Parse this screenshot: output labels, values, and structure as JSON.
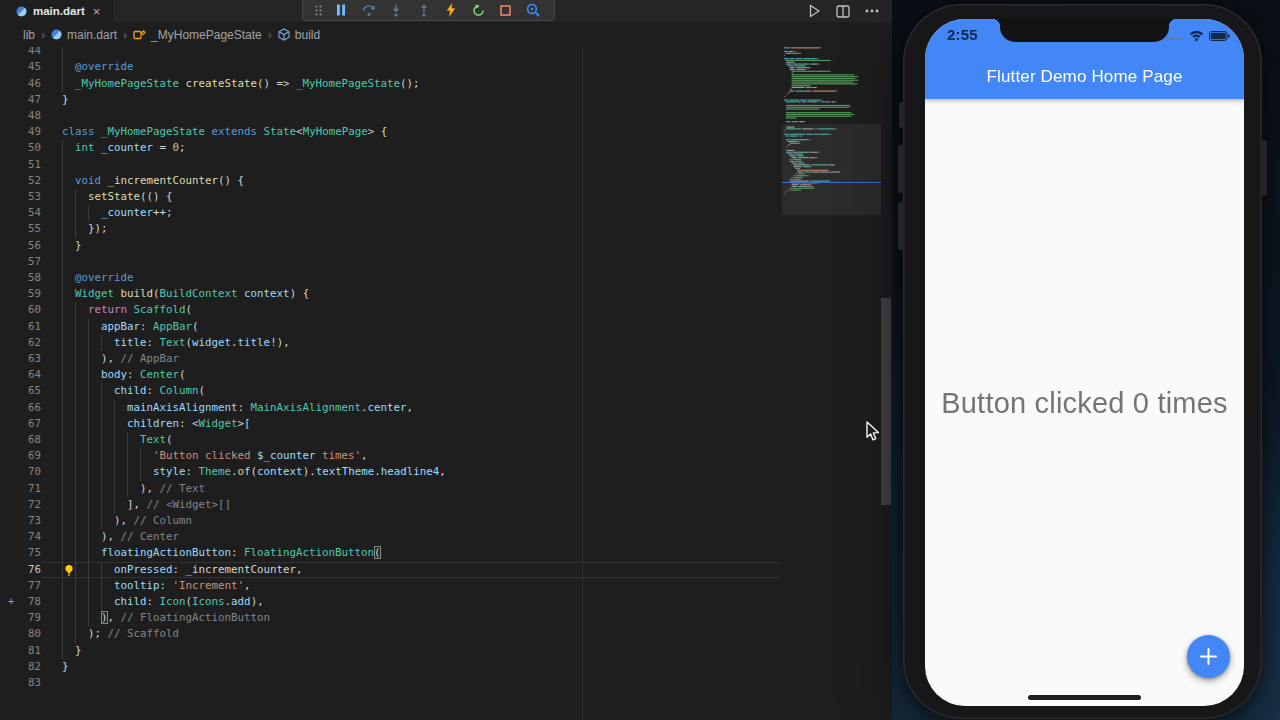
{
  "vscode": {
    "tab_bar": {
      "active_tab": {
        "label": "main.dart",
        "icon": "dart-icon",
        "close_label": "×"
      },
      "editor_actions": [
        {
          "name": "run-button",
          "icon": "play-icon"
        },
        {
          "name": "split-editor-button",
          "icon": "split-editor-icon"
        },
        {
          "name": "more-actions-button",
          "icon": "ellipsis-icon"
        }
      ]
    },
    "debug_toolbar": {
      "items": [
        {
          "name": "drag-grip",
          "icon": "grip-dots-icon",
          "enabled": true
        },
        {
          "name": "pause-button",
          "icon": "pause-icon",
          "enabled": true,
          "color": "#75beff"
        },
        {
          "name": "step-over-button",
          "icon": "step-over-icon",
          "enabled": false,
          "color": "#5b7a94"
        },
        {
          "name": "step-into-button",
          "icon": "step-into-icon",
          "enabled": false,
          "color": "#5b7a94"
        },
        {
          "name": "step-out-button",
          "icon": "step-out-icon",
          "enabled": false,
          "color": "#5b7a94"
        },
        {
          "name": "hot-reload-button",
          "icon": "lightning-bolt-icon",
          "enabled": true,
          "color": "#ffb62e"
        },
        {
          "name": "restart-button",
          "icon": "restart-icon",
          "enabled": true,
          "color": "#89d185"
        },
        {
          "name": "stop-button",
          "icon": "stop-square-icon",
          "enabled": true,
          "color": "#f48771"
        },
        {
          "name": "widget-inspector-button",
          "icon": "inspector-magnifier-icon",
          "enabled": true,
          "color": "#3794ff"
        }
      ]
    },
    "breadcrumbs": [
      {
        "label": "lib",
        "icon": null
      },
      {
        "label": "main.dart",
        "icon": "dart-icon"
      },
      {
        "label": "_MyHomePageState",
        "icon": "symbol-class-icon"
      },
      {
        "label": "build",
        "icon": "symbol-method-icon"
      }
    ],
    "editor": {
      "current_line": 76,
      "token_colors": {
        "kw": "#569cd6",
        "ctl": "#c586c0",
        "type": "#4ec9b0",
        "fn": "#dcdcaa",
        "var": "#9cdcfe",
        "str": "#ce9178",
        "num": "#b5cea8",
        "cmt": "#85858a",
        "pun": "#d4d4d4"
      },
      "gutter_decorations": {
        "76": "lightbulb-icon",
        "78": "plus-icon"
      },
      "lines": [
        {
          "n": 44,
          "ind": 0,
          "t": []
        },
        {
          "n": 45,
          "ind": 2,
          "t": [
            [
              "@override",
              "kw"
            ]
          ]
        },
        {
          "n": 46,
          "ind": 2,
          "t": [
            [
              "_MyHomePageState",
              "type"
            ],
            [
              " ",
              "pun"
            ],
            [
              "createState",
              "fn"
            ],
            [
              "() => ",
              "pun"
            ],
            [
              "_MyHomePageState",
              "type"
            ],
            [
              "();",
              "pun"
            ]
          ]
        },
        {
          "n": 47,
          "ind": 0,
          "t": [
            [
              "}",
              "pun"
            ]
          ]
        },
        {
          "n": 48,
          "ind": 0,
          "t": []
        },
        {
          "n": 49,
          "ind": 0,
          "t": [
            [
              "class",
              "kw"
            ],
            [
              " ",
              "pun"
            ],
            [
              "_MyHomePageState",
              "type"
            ],
            [
              " ",
              "pun"
            ],
            [
              "extends",
              "kw"
            ],
            [
              " ",
              "pun"
            ],
            [
              "State",
              "type"
            ],
            [
              "<",
              "pun"
            ],
            [
              "MyHomePage",
              "type"
            ],
            [
              "> {",
              "pun"
            ]
          ]
        },
        {
          "n": 50,
          "ind": 2,
          "t": [
            [
              "int",
              "type"
            ],
            [
              " ",
              "pun"
            ],
            [
              "_counter",
              "var"
            ],
            [
              " = ",
              "pun"
            ],
            [
              "0",
              "num"
            ],
            [
              ";",
              "pun"
            ]
          ]
        },
        {
          "n": 51,
          "ind": 2,
          "t": []
        },
        {
          "n": 52,
          "ind": 2,
          "t": [
            [
              "void",
              "kw"
            ],
            [
              " ",
              "pun"
            ],
            [
              "_incrementCounter",
              "fn"
            ],
            [
              "() {",
              "pun"
            ]
          ]
        },
        {
          "n": 53,
          "ind": 4,
          "t": [
            [
              "setState",
              "fn"
            ],
            [
              "(() {",
              "pun"
            ]
          ]
        },
        {
          "n": 54,
          "ind": 6,
          "t": [
            [
              "_counter",
              "var"
            ],
            [
              "++;",
              "pun"
            ]
          ]
        },
        {
          "n": 55,
          "ind": 4,
          "t": [
            [
              "});",
              "pun"
            ]
          ]
        },
        {
          "n": 56,
          "ind": 2,
          "t": [
            [
              "}",
              "pun"
            ]
          ]
        },
        {
          "n": 57,
          "ind": 2,
          "t": []
        },
        {
          "n": 58,
          "ind": 2,
          "t": [
            [
              "@override",
              "kw"
            ]
          ]
        },
        {
          "n": 59,
          "ind": 2,
          "t": [
            [
              "Widget",
              "type"
            ],
            [
              " ",
              "pun"
            ],
            [
              "build",
              "fn"
            ],
            [
              "(",
              "pun"
            ],
            [
              "BuildContext",
              "type"
            ],
            [
              " ",
              "pun"
            ],
            [
              "context",
              "var"
            ],
            [
              ") {",
              "pun"
            ]
          ]
        },
        {
          "n": 60,
          "ind": 4,
          "t": [
            [
              "return",
              "ctl"
            ],
            [
              " ",
              "pun"
            ],
            [
              "Scaffold",
              "type"
            ],
            [
              "(",
              "pun"
            ]
          ]
        },
        {
          "n": 61,
          "ind": 6,
          "t": [
            [
              "appBar",
              "var"
            ],
            [
              ": ",
              "pun"
            ],
            [
              "AppBar",
              "type"
            ],
            [
              "(",
              "pun"
            ]
          ]
        },
        {
          "n": 62,
          "ind": 8,
          "t": [
            [
              "title",
              "var"
            ],
            [
              ": ",
              "pun"
            ],
            [
              "Text",
              "type"
            ],
            [
              "(",
              "pun"
            ],
            [
              "widget",
              "var"
            ],
            [
              ".",
              "pun"
            ],
            [
              "title",
              "var"
            ],
            [
              "!),",
              "pun"
            ]
          ]
        },
        {
          "n": 63,
          "ind": 6,
          "t": [
            [
              "), ",
              "pun"
            ],
            [
              "// AppBar",
              "cmt"
            ]
          ]
        },
        {
          "n": 64,
          "ind": 6,
          "t": [
            [
              "body",
              "var"
            ],
            [
              ": ",
              "pun"
            ],
            [
              "Center",
              "type"
            ],
            [
              "(",
              "pun"
            ]
          ]
        },
        {
          "n": 65,
          "ind": 8,
          "t": [
            [
              "child",
              "var"
            ],
            [
              ": ",
              "pun"
            ],
            [
              "Column",
              "type"
            ],
            [
              "(",
              "pun"
            ]
          ]
        },
        {
          "n": 66,
          "ind": 10,
          "t": [
            [
              "mainAxisAlignment",
              "var"
            ],
            [
              ": ",
              "pun"
            ],
            [
              "MainAxisAlignment",
              "type"
            ],
            [
              ".",
              "pun"
            ],
            [
              "center",
              "var"
            ],
            [
              ",",
              "pun"
            ]
          ]
        },
        {
          "n": 67,
          "ind": 10,
          "t": [
            [
              "children",
              "var"
            ],
            [
              ": <",
              "pun"
            ],
            [
              "Widget",
              "type"
            ],
            [
              ">[",
              "pun"
            ]
          ]
        },
        {
          "n": 68,
          "ind": 12,
          "t": [
            [
              "Text",
              "type"
            ],
            [
              "(",
              "pun"
            ]
          ]
        },
        {
          "n": 69,
          "ind": 14,
          "t": [
            [
              "'Button clicked ",
              "str"
            ],
            [
              "$_counter",
              "var"
            ],
            [
              " times'",
              "str"
            ],
            [
              ",",
              "pun"
            ]
          ]
        },
        {
          "n": 70,
          "ind": 14,
          "t": [
            [
              "style",
              "var"
            ],
            [
              ": ",
              "pun"
            ],
            [
              "Theme",
              "type"
            ],
            [
              ".",
              "pun"
            ],
            [
              "of",
              "fn"
            ],
            [
              "(",
              "pun"
            ],
            [
              "context",
              "var"
            ],
            [
              ").",
              "pun"
            ],
            [
              "textTheme",
              "var"
            ],
            [
              ".",
              "pun"
            ],
            [
              "headline4",
              "var"
            ],
            [
              ",",
              "pun"
            ]
          ]
        },
        {
          "n": 71,
          "ind": 12,
          "t": [
            [
              "), ",
              "pun"
            ],
            [
              "// Text",
              "cmt"
            ]
          ]
        },
        {
          "n": 72,
          "ind": 10,
          "t": [
            [
              "], ",
              "pun"
            ],
            [
              "// <Widget>[]",
              "cmt"
            ]
          ]
        },
        {
          "n": 73,
          "ind": 8,
          "t": [
            [
              "), ",
              "pun"
            ],
            [
              "// Column",
              "cmt"
            ]
          ]
        },
        {
          "n": 74,
          "ind": 6,
          "t": [
            [
              "), ",
              "pun"
            ],
            [
              "// Center",
              "cmt"
            ]
          ]
        },
        {
          "n": 75,
          "ind": 6,
          "t": [
            [
              "floatingActionButton",
              "var"
            ],
            [
              ": ",
              "pun"
            ],
            [
              "FloatingActionButton",
              "type"
            ],
            [
              "(",
              "pun",
              "m"
            ]
          ]
        },
        {
          "n": 76,
          "ind": 8,
          "t": [
            [
              "onPressed",
              "var"
            ],
            [
              ": ",
              "pun"
            ],
            [
              "_incrementCounter",
              "pun"
            ],
            [
              ",",
              "pun"
            ]
          ]
        },
        {
          "n": 77,
          "ind": 8,
          "t": [
            [
              "tooltip",
              "var"
            ],
            [
              ": ",
              "pun"
            ],
            [
              "'Increment'",
              "str"
            ],
            [
              ",",
              "pun"
            ]
          ]
        },
        {
          "n": 78,
          "ind": 8,
          "t": [
            [
              "child",
              "var"
            ],
            [
              ": ",
              "pun"
            ],
            [
              "Icon",
              "type"
            ],
            [
              "(",
              "pun"
            ],
            [
              "Icons",
              "type"
            ],
            [
              ".",
              "pun"
            ],
            [
              "add",
              "var"
            ],
            [
              "),",
              "pun"
            ]
          ]
        },
        {
          "n": 79,
          "ind": 6,
          "t": [
            [
              ")",
              "pun",
              "m"
            ],
            [
              ", ",
              "pun"
            ],
            [
              "// FloatingActionButton",
              "cmt"
            ]
          ]
        },
        {
          "n": 80,
          "ind": 4,
          "t": [
            [
              "); ",
              "pun"
            ],
            [
              "// Scaffold",
              "cmt"
            ]
          ]
        },
        {
          "n": 81,
          "ind": 2,
          "t": [
            [
              "}",
              "pun"
            ]
          ]
        },
        {
          "n": 82,
          "ind": 0,
          "t": [
            [
              "}",
              "pun"
            ]
          ]
        },
        {
          "n": 83,
          "ind": 0,
          "t": []
        }
      ]
    },
    "minimap": {
      "file_lines": [
        "import 'package:flutter/material.dart';",
        "",
        "void main() {",
        "  runApp(MyApp());",
        "}",
        "",
        "class MyApp extends StatelessWidget {",
        "  // This widget is the root of your application.",
        "  @override",
        "  Widget build(BuildContext context) {",
        "    return MaterialApp(",
        "      title: 'Flutter Demo',",
        "      theme: ThemeData(",
        "        // This is the theme of your application.",
        "        //",
        "        // Try running your application with \"flutter run\". You'll see the",
        "        // application has a blue toolbar. Then, without quitting the app, try",
        "        // changing the primarySwatch below to Colors.green and then invoke",
        "        // \"hot reload\" (press \"r\" in the console where you ran \"flutter run\",",
        "        // or simply save your changes to \"hot reload\" in a Flutter IDE).",
        "        // Notice that the counter didn't reset back to zero; the application",
        "        // is not restarted.",
        "        primarySwatch: Colors.blue,",
        "      ),",
        "      home: MyHomePage(title: 'Flutter Demo Home Page'),",
        "    );",
        "  }",
        "}",
        "",
        "class MyHomePage extends StatefulWidget {",
        "  MyHomePage({Key? key, this.title}) : super(key: key);",
        "",
        "  // This widget is the home page of your application. It is stateful,",
        "  // meaning that it has a State object (defined below) that contains",
        "  // fields that affect how it looks.",
        "",
        "  // This class is the configuration for the state. It holds the values",
        "  // (in this case the title) provided by the parent and used by the build",
        "  // method of the State. Fields in a Widget subclass are always marked",
        "  // \"final\".",
        "",
        "  final String? title;",
        "",
        "",
        "  @override",
        "  _MyHomePageState createState() => _MyHomePageState();",
        "}",
        "",
        "class _MyHomePageState extends State<MyHomePage> {",
        "  int _counter = 0;",
        "",
        "  void _incrementCounter() {",
        "    setState(() {",
        "      _counter++;",
        "    });",
        "  }",
        "",
        "  @override",
        "  Widget build(BuildContext context) {",
        "    return Scaffold(",
        "      appBar: AppBar(",
        "        title: Text(widget.title!),",
        "      ), // AppBar",
        "      body: Center(",
        "        child: Column(",
        "          mainAxisAlignment: MainAxisAlignment.center,",
        "          children: <Widget>[",
        "            Text(",
        "              'Button clicked $_counter times',",
        "              style: Theme.of(context).textTheme.headline4,",
        "            ), // Text",
        "          ], // <Widget>[]",
        "        ), // Column",
        "      ), // Center",
        "      floatingActionButton: FloatingActionButton(",
        "        onPressed: _incrementCounter,",
        "        tooltip: 'Increment',",
        "        child: Icon(Icons.add),",
        "      ), // FloatingActionButton",
        "    ); // Scaffold",
        "  }",
        "}",
        ""
      ]
    }
  },
  "simulator": {
    "status_bar": {
      "time": "2:55",
      "icons": [
        "cellular-dots-icon",
        "wifi-icon",
        "battery-icon"
      ]
    },
    "app_bar": {
      "title": "Flutter Demo Home Page",
      "color": "#4287f5"
    },
    "body": {
      "counter_text": "Button clicked 0 times",
      "background": "#fafafa"
    },
    "fab": {
      "icon": "plus-icon",
      "color": "#4287f5",
      "tooltip": "Increment"
    }
  },
  "desktop": {
    "mouse_cursor": "arrow-pointer"
  }
}
